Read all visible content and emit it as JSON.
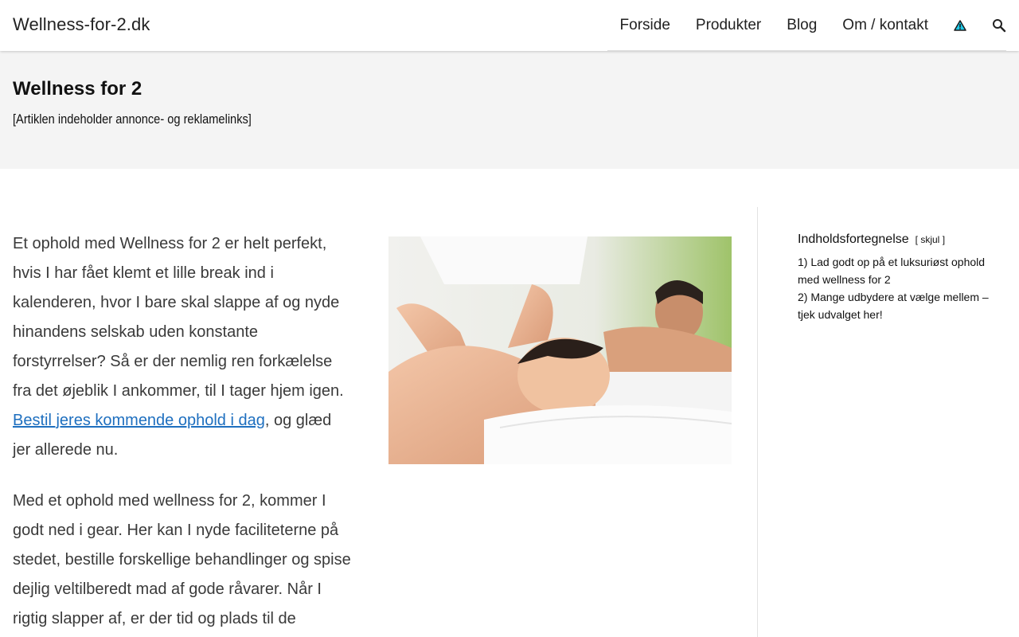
{
  "header": {
    "site_title": "Wellness-for-2.dk",
    "nav": [
      "Forside",
      "Produkter",
      "Blog",
      "Om / kontakt"
    ],
    "icons": [
      "warning-triangle-icon",
      "search-icon"
    ]
  },
  "hero": {
    "title": "Wellness for 2",
    "note": "[Artiklen indeholder annonce- og reklamelinks]"
  },
  "article": {
    "p1_before": "Et ophold med Wellness for 2 er helt perfekt, hvis I har fået klemt et lille break ind i kalenderen, hvor I bare skal slappe af og nyde hinandens selskab uden konstante forstyrrelser? Så er der nemlig ren forkælelse fra det øjeblik I ankommer, til I tager hjem igen. ",
    "p1_link": "Bestil jeres kommende ophold i dag",
    "p1_after": ", og glæd jer allerede nu.",
    "p2": "Med et ophold med wellness for 2, kommer I godt ned i gear. Her kan I nyde faciliteterne på stedet, bestille forskellige behandlinger og spise dejlig veltilberedt mad af gode råvarer. Når I rigtig slapper af, er der tid og plads til de"
  },
  "toc": {
    "heading": "Indholdsfortegnelse",
    "toggle_open": "[",
    "toggle_label": "skjul",
    "toggle_close": "]",
    "items": [
      "1) Lad godt op på et luksuriøst ophold med wellness for 2",
      "2) Mange udbydere at vælge mellem – tjek udvalget her!"
    ]
  },
  "colors": {
    "link": "#1e6fbf",
    "hero_bg": "#f4f4f4"
  }
}
